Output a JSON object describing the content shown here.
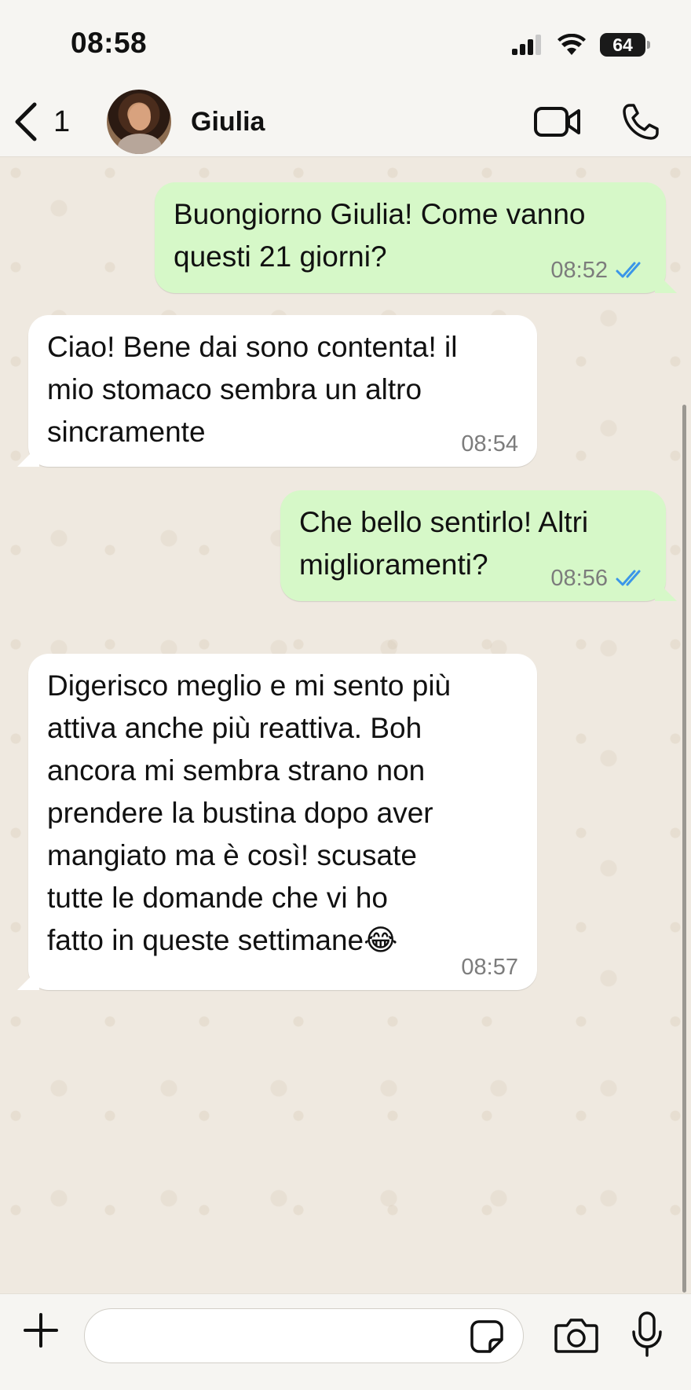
{
  "status_bar": {
    "time": "08:58",
    "battery": "64"
  },
  "header": {
    "back_count": "1",
    "contact_name": "Giulia"
  },
  "messages": [
    {
      "direction": "out",
      "text": "Buongiorno Giulia! Come vanno\nquesti 21 giorni?",
      "time": "08:52",
      "status": "read"
    },
    {
      "direction": "in",
      "text": "Ciao! Bene dai sono contenta! il\nmio stomaco sembra un altro\nsincramente",
      "time": "08:54"
    },
    {
      "direction": "out",
      "text": "Che bello sentirlo! Altri\nmiglioramenti?",
      "time": "08:56",
      "status": "read"
    },
    {
      "direction": "in",
      "text": "Digerisco meglio e mi sento più\nattiva anche più reattiva. Boh\nancora mi sembra strano non\nprendere la bustina dopo aver\nmangiato ma è così! scusate\ntutte le domande che vi ho\nfatto in queste settimane😂",
      "time": "08:57"
    }
  ],
  "input": {
    "value": "",
    "placeholder": ""
  },
  "colors": {
    "outgoing_bubble": "#d6f8c8",
    "incoming_bubble": "#ffffff",
    "read_ticks": "#3b96e8",
    "wallpaper": "#efe9e0"
  },
  "icons": {
    "back": "chevron-left-icon",
    "video": "video-camera-icon",
    "call": "phone-icon",
    "add": "plus-icon",
    "sticker": "sticker-icon",
    "camera": "camera-icon",
    "mic": "microphone-icon"
  }
}
